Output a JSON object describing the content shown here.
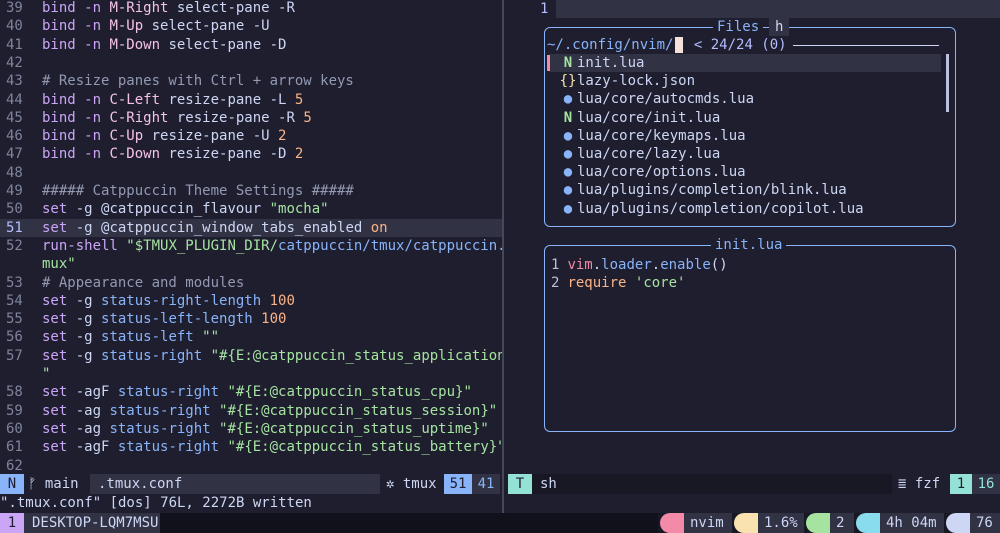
{
  "editor": {
    "filename": ".tmux.conf",
    "lines": [
      {
        "n": "39",
        "parts": [
          [
            "kw",
            "bind -n "
          ],
          [
            "var",
            "M-Right"
          ],
          [
            "txt",
            " select-pane -R"
          ]
        ]
      },
      {
        "n": "40",
        "parts": [
          [
            "kw",
            "bind -n "
          ],
          [
            "var",
            "M-Up"
          ],
          [
            "txt",
            " select-pane -U"
          ]
        ]
      },
      {
        "n": "41",
        "parts": [
          [
            "kw",
            "bind -n "
          ],
          [
            "var",
            "M-Down"
          ],
          [
            "txt",
            " select-pane -D"
          ]
        ]
      },
      {
        "n": "42",
        "parts": []
      },
      {
        "n": "43",
        "parts": [
          [
            "com",
            "# Resize panes with Ctrl + arrow keys"
          ]
        ]
      },
      {
        "n": "44",
        "parts": [
          [
            "kw",
            "bind -n "
          ],
          [
            "var",
            "C-Left"
          ],
          [
            "txt",
            " resize-pane -L "
          ],
          [
            "num",
            "5"
          ]
        ]
      },
      {
        "n": "45",
        "parts": [
          [
            "kw",
            "bind -n "
          ],
          [
            "var",
            "C-Right"
          ],
          [
            "txt",
            " resize-pane -R "
          ],
          [
            "num",
            "5"
          ]
        ]
      },
      {
        "n": "46",
        "parts": [
          [
            "kw",
            "bind -n "
          ],
          [
            "var",
            "C-Up"
          ],
          [
            "txt",
            " resize-pane -U "
          ],
          [
            "num",
            "2"
          ]
        ]
      },
      {
        "n": "47",
        "parts": [
          [
            "kw",
            "bind -n "
          ],
          [
            "var",
            "C-Down"
          ],
          [
            "txt",
            " resize-pane -D "
          ],
          [
            "num",
            "2"
          ]
        ]
      },
      {
        "n": "48",
        "parts": []
      },
      {
        "n": "49",
        "parts": [
          [
            "com",
            "##### Catppuccin Theme Settings #####"
          ]
        ]
      },
      {
        "n": "50",
        "parts": [
          [
            "kw",
            "set"
          ],
          [
            "txt",
            " -g @catppuccin_flavour "
          ],
          [
            "str",
            "\"mocha\""
          ]
        ]
      },
      {
        "n": "51",
        "cur": true,
        "parts": [
          [
            "kw",
            "set"
          ],
          [
            "txt",
            " -g @catppuccin_window_tabs_enabled "
          ],
          [
            "num",
            "on"
          ]
        ]
      },
      {
        "n": "52",
        "parts": [
          [
            "kw",
            "run-shell "
          ],
          [
            "str",
            "\"$TMUX_PLUGIN_DIR/"
          ],
          [
            "opt",
            "catppuccin/tmux/catppuccin.t"
          ]
        ]
      },
      {
        "n": "",
        "parts": [
          [
            "str",
            "mux\""
          ]
        ]
      },
      {
        "n": "53",
        "parts": [
          [
            "com",
            "# Appearance and modules"
          ]
        ]
      },
      {
        "n": "54",
        "parts": [
          [
            "kw",
            "set"
          ],
          [
            "txt",
            " -g "
          ],
          [
            "opt",
            "status-right-length"
          ],
          [
            "num",
            " 100"
          ]
        ]
      },
      {
        "n": "55",
        "parts": [
          [
            "kw",
            "set"
          ],
          [
            "txt",
            " -g "
          ],
          [
            "opt",
            "status-left-length"
          ],
          [
            "num",
            " 100"
          ]
        ]
      },
      {
        "n": "56",
        "parts": [
          [
            "kw",
            "set"
          ],
          [
            "txt",
            " -g "
          ],
          [
            "opt",
            "status-left"
          ],
          [
            "str",
            " \"\""
          ]
        ]
      },
      {
        "n": "57",
        "parts": [
          [
            "kw",
            "set"
          ],
          [
            "txt",
            " -g "
          ],
          [
            "opt",
            "status-right"
          ],
          [
            "str",
            " \"#{E:@catppuccin_status_application}"
          ]
        ]
      },
      {
        "n": "",
        "parts": [
          [
            "str",
            "\""
          ]
        ]
      },
      {
        "n": "58",
        "parts": [
          [
            "kw",
            "set"
          ],
          [
            "txt",
            " -agF "
          ],
          [
            "opt",
            "status-right"
          ],
          [
            "str",
            " \"#{E:@catppuccin_status_cpu}\""
          ]
        ]
      },
      {
        "n": "59",
        "parts": [
          [
            "kw",
            "set"
          ],
          [
            "txt",
            " -ag "
          ],
          [
            "opt",
            "status-right"
          ],
          [
            "str",
            " \"#{E:@catppuccin_status_session}\""
          ]
        ]
      },
      {
        "n": "60",
        "parts": [
          [
            "kw",
            "set"
          ],
          [
            "txt",
            " -ag "
          ],
          [
            "opt",
            "status-right"
          ],
          [
            "str",
            " \"#{E:@catppuccin_status_uptime}\""
          ]
        ]
      },
      {
        "n": "61",
        "parts": [
          [
            "kw",
            "set"
          ],
          [
            "txt",
            " -agF "
          ],
          [
            "opt",
            "status-right"
          ],
          [
            "str",
            " \"#{E:@catppuccin_status_battery}\""
          ]
        ]
      },
      {
        "n": "62",
        "parts": []
      }
    ]
  },
  "terminal": {
    "line_number": "1",
    "files_title": "Files",
    "files_title_key": "h",
    "prompt_path": "~/.config/nvim/",
    "prompt_count": "< 24/24 (0)",
    "files": [
      {
        "icon": "N",
        "icon_kind": "nvim",
        "name": "init.lua",
        "selected": true
      },
      {
        "icon": "{}",
        "icon_kind": "json",
        "name": "lazy-lock.json"
      },
      {
        "icon": "●",
        "icon_kind": "lua",
        "name": "lua/core/autocmds.lua"
      },
      {
        "icon": "N",
        "icon_kind": "nvim",
        "name": "lua/core/init.lua"
      },
      {
        "icon": "●",
        "icon_kind": "lua",
        "name": "lua/core/keymaps.lua"
      },
      {
        "icon": "●",
        "icon_kind": "lua",
        "name": "lua/core/lazy.lua"
      },
      {
        "icon": "●",
        "icon_kind": "lua",
        "name": "lua/core/options.lua"
      },
      {
        "icon": "●",
        "icon_kind": "lua",
        "name": "lua/plugins/completion/blink.lua"
      },
      {
        "icon": "●",
        "icon_kind": "lua",
        "name": "lua/plugins/completion/copilot.lua"
      }
    ],
    "preview_title": "init.lua",
    "preview_lines": [
      {
        "n": "1",
        "parts": [
          [
            "var",
            "vim"
          ],
          [
            "txt",
            "."
          ],
          [
            "fn",
            "loader"
          ],
          [
            "txt",
            "."
          ],
          [
            "fn",
            "enable"
          ],
          [
            "txt",
            "()"
          ]
        ]
      },
      {
        "n": "2",
        "parts": [
          [
            "kw",
            "require"
          ],
          [
            "txt",
            " "
          ],
          [
            "str",
            "'core'"
          ]
        ]
      }
    ]
  },
  "statusline": {
    "mode": "N",
    "branch_icon": "ᚠ",
    "branch": "main",
    "filename": ".tmux.conf",
    "filetype_icon": "✲",
    "filetype": "tmux",
    "line": "51",
    "col": "41",
    "term_mode": "T",
    "term_cmd": "sh",
    "term_ft_icon": "≣",
    "term_ft": "fzf",
    "term_line": "1",
    "term_col": "16"
  },
  "message": "\".tmux.conf\" [dos] 76L, 2272B written",
  "tmux": {
    "window_index": "1",
    "window_name": "DESKTOP-LQM7MSU",
    "application": "nvim",
    "cpu": "1.6%",
    "session": "2",
    "uptime": "4h 04m",
    "battery": "76"
  }
}
